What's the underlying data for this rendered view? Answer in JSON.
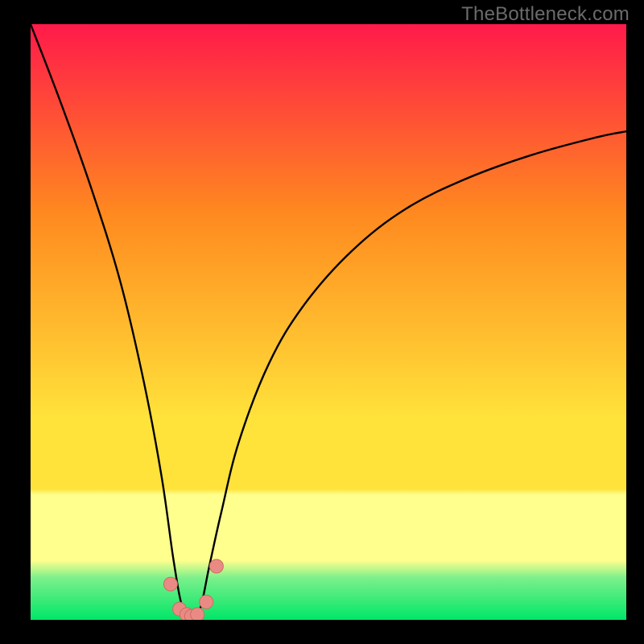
{
  "watermark": "TheBottleneck.com",
  "colors": {
    "bg": "#000000",
    "grad_red": "#ff1a4a",
    "grad_orange": "#ff8a1f",
    "grad_yellow_top": "#ffe23a",
    "grad_yellow_band": "#ffff8e",
    "grad_green_light": "#7af08b",
    "grad_green": "#00e667",
    "curve": "#000000",
    "marker_fill": "#e98b84",
    "marker_stroke": "#cf6b62"
  },
  "chart_data": {
    "type": "line",
    "title": "",
    "xlabel": "",
    "ylabel": "",
    "ylim": [
      0,
      100
    ],
    "xlim": [
      0,
      100
    ],
    "series": [
      {
        "name": "bottleneck-curve",
        "x": [
          0,
          5,
          10,
          15,
          19,
          22,
          24,
          25.5,
          27,
          28.5,
          30,
          32,
          35,
          40,
          46,
          54,
          63,
          73,
          84,
          95,
          100
        ],
        "y": [
          100,
          87,
          73,
          57,
          40,
          24,
          10,
          2,
          0,
          2,
          9,
          18,
          30,
          43,
          53,
          62,
          69,
          74,
          78,
          81,
          82
        ]
      }
    ],
    "markers": {
      "name": "highlight-points",
      "x": [
        23.5,
        25.0,
        26.2,
        27.0,
        28.0,
        29.5,
        31.2
      ],
      "y": [
        6.0,
        1.8,
        0.9,
        0.6,
        0.9,
        3.0,
        9.0
      ]
    }
  }
}
